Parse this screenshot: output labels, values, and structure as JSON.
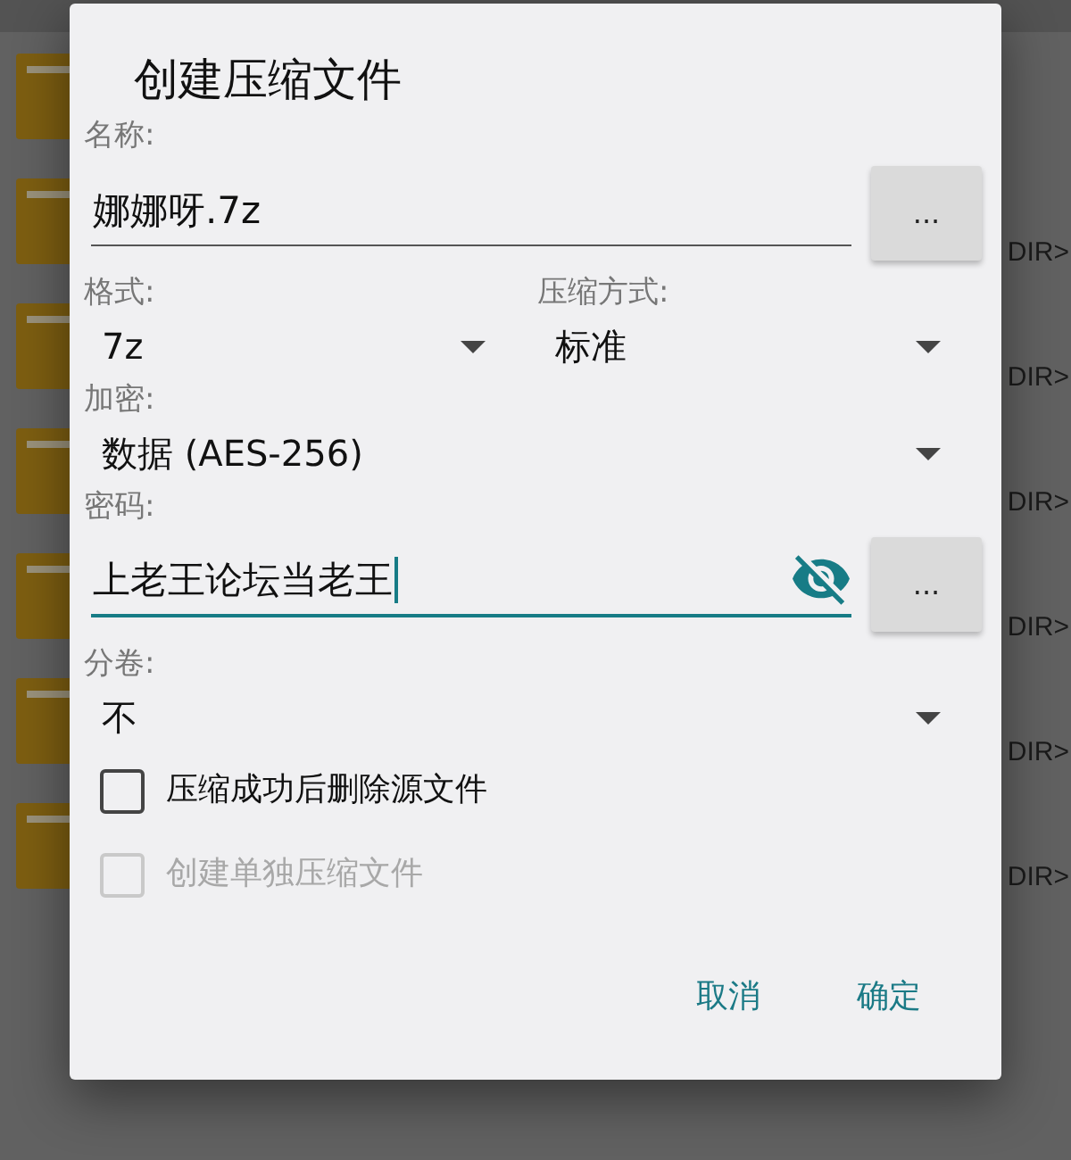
{
  "file_list": {
    "rows": [
      {
        "kind": "folder"
      },
      {
        "kind": "folder",
        "tag": "DIR>"
      },
      {
        "kind": "folder",
        "tag": "DIR>"
      },
      {
        "kind": "folder",
        "tag": "DIR>"
      },
      {
        "kind": "folder",
        "tag": "DIR>"
      },
      {
        "kind": "folder",
        "tag": "DIR>"
      },
      {
        "kind": "folder",
        "tag": "DIR>"
      }
    ]
  },
  "dialog": {
    "title": "创建压缩文件",
    "fields": [
      {
        "kind": "input",
        "label": "名称:",
        "value": "娜娜呀.7z",
        "focused": false,
        "button": "..."
      },
      {
        "kind": "row",
        "items": [
          {
            "kind": "dropdown",
            "label": "格式:",
            "value": "7z"
          },
          {
            "kind": "dropdown",
            "label": "压缩方式:",
            "value": "标准"
          }
        ]
      },
      {
        "kind": "dropdown",
        "label": "加密:",
        "value": "数据 (AES-256)"
      },
      {
        "kind": "password",
        "label": "密码:",
        "value": "上老王论坛当老王",
        "focused": true,
        "visible": true,
        "button": "..."
      },
      {
        "kind": "dropdown",
        "label": "分卷:",
        "value": "不"
      }
    ],
    "checkboxes": [
      {
        "label": "压缩成功后删除源文件",
        "checked": false,
        "disabled": false
      },
      {
        "label": "创建单独压缩文件",
        "checked": false,
        "disabled": true
      }
    ],
    "buttons": [
      "取消",
      "确定"
    ]
  }
}
